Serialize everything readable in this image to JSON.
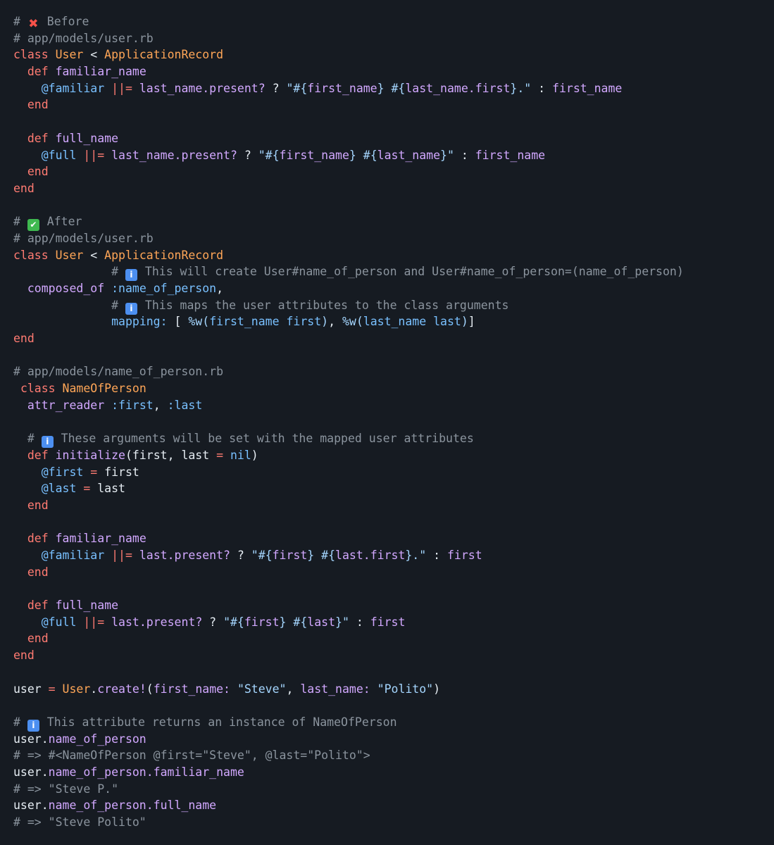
{
  "editor": {
    "theme_colors": {
      "background": "#161b22",
      "comment": "#8b949e",
      "keyword": "#ff7b72",
      "class": "#ffa657",
      "method": "#d2a8ff",
      "variable": "#79c0ff",
      "string": "#a5d6ff",
      "plain": "#e6edf3"
    },
    "lines": [
      [
        [
          "comment",
          "# "
        ],
        [
          "icon",
          "cross-mark-icon"
        ],
        [
          "comment",
          " Before"
        ]
      ],
      [
        [
          "comment",
          "# app/models/user.rb"
        ]
      ],
      [
        [
          "keyword",
          "class "
        ],
        [
          "class",
          "User"
        ],
        [
          "plain",
          " < "
        ],
        [
          "class",
          "ApplicationRecord"
        ]
      ],
      [
        [
          "plain",
          "  "
        ],
        [
          "keyword",
          "def "
        ],
        [
          "method",
          "familiar_name"
        ]
      ],
      [
        [
          "plain",
          "    "
        ],
        [
          "var",
          "@familiar"
        ],
        [
          "plain",
          " "
        ],
        [
          "op",
          "||="
        ],
        [
          "plain",
          " "
        ],
        [
          "method",
          "last_name.present?"
        ],
        [
          "plain",
          " ? "
        ],
        [
          "string",
          "\"#{"
        ],
        [
          "method",
          "first_name"
        ],
        [
          "string",
          "} #{"
        ],
        [
          "method",
          "last_name.first"
        ],
        [
          "string",
          "}.\""
        ],
        [
          "plain",
          " : "
        ],
        [
          "method",
          "first_name"
        ]
      ],
      [
        [
          "plain",
          "  "
        ],
        [
          "keyword",
          "end"
        ]
      ],
      [],
      [
        [
          "plain",
          "  "
        ],
        [
          "keyword",
          "def "
        ],
        [
          "method",
          "full_name"
        ]
      ],
      [
        [
          "plain",
          "    "
        ],
        [
          "var",
          "@full"
        ],
        [
          "plain",
          " "
        ],
        [
          "op",
          "||="
        ],
        [
          "plain",
          " "
        ],
        [
          "method",
          "last_name.present?"
        ],
        [
          "plain",
          " ? "
        ],
        [
          "string",
          "\"#{"
        ],
        [
          "method",
          "first_name"
        ],
        [
          "string",
          "} #{"
        ],
        [
          "method",
          "last_name"
        ],
        [
          "string",
          "}\""
        ],
        [
          "plain",
          " : "
        ],
        [
          "method",
          "first_name"
        ]
      ],
      [
        [
          "plain",
          "  "
        ],
        [
          "keyword",
          "end"
        ]
      ],
      [
        [
          "keyword",
          "end"
        ]
      ],
      [],
      [
        [
          "comment",
          "# "
        ],
        [
          "icon",
          "check-mark-icon"
        ],
        [
          "comment",
          " After"
        ]
      ],
      [
        [
          "comment",
          "# app/models/user.rb"
        ]
      ],
      [
        [
          "keyword",
          "class "
        ],
        [
          "class",
          "User"
        ],
        [
          "plain",
          " < "
        ],
        [
          "class",
          "ApplicationRecord"
        ]
      ],
      [
        [
          "plain",
          "              "
        ],
        [
          "comment",
          "# "
        ],
        [
          "icon",
          "info-icon"
        ],
        [
          "comment",
          " This will create User#name_of_person and User#name_of_person=(name_of_person)"
        ]
      ],
      [
        [
          "plain",
          "  "
        ],
        [
          "method",
          "composed_of"
        ],
        [
          "plain",
          " "
        ],
        [
          "var",
          ":name_of_person"
        ],
        [
          "plain",
          ","
        ]
      ],
      [
        [
          "plain",
          "              "
        ],
        [
          "comment",
          "# "
        ],
        [
          "icon",
          "info-icon"
        ],
        [
          "comment",
          " This maps the user attributes to the class arguments"
        ]
      ],
      [
        [
          "plain",
          "              "
        ],
        [
          "var",
          "mapping:"
        ],
        [
          "plain",
          " [ "
        ],
        [
          "string",
          "%w("
        ],
        [
          "var",
          "first_name first"
        ],
        [
          "string",
          ")"
        ],
        [
          "plain",
          ", "
        ],
        [
          "string",
          "%w("
        ],
        [
          "var",
          "last_name last"
        ],
        [
          "string",
          ")"
        ],
        [
          "plain",
          "]"
        ]
      ],
      [
        [
          "keyword",
          "end"
        ]
      ],
      [],
      [
        [
          "comment",
          "# app/models/name_of_person.rb"
        ]
      ],
      [
        [
          "plain",
          " "
        ],
        [
          "keyword",
          "class "
        ],
        [
          "class",
          "NameOfPerson"
        ]
      ],
      [
        [
          "plain",
          "  "
        ],
        [
          "method",
          "attr_reader"
        ],
        [
          "plain",
          " "
        ],
        [
          "var",
          ":first"
        ],
        [
          "plain",
          ", "
        ],
        [
          "var",
          ":last"
        ]
      ],
      [],
      [
        [
          "plain",
          "  "
        ],
        [
          "comment",
          "# "
        ],
        [
          "icon",
          "info-icon"
        ],
        [
          "comment",
          " These arguments will be set with the mapped user attributes"
        ]
      ],
      [
        [
          "plain",
          "  "
        ],
        [
          "keyword",
          "def "
        ],
        [
          "method",
          "initialize"
        ],
        [
          "plain",
          "(first, last "
        ],
        [
          "op",
          "="
        ],
        [
          "plain",
          " "
        ],
        [
          "const",
          "nil"
        ],
        [
          "plain",
          ")"
        ]
      ],
      [
        [
          "plain",
          "    "
        ],
        [
          "var",
          "@first"
        ],
        [
          "plain",
          " "
        ],
        [
          "op",
          "="
        ],
        [
          "plain",
          " first"
        ]
      ],
      [
        [
          "plain",
          "    "
        ],
        [
          "var",
          "@last"
        ],
        [
          "plain",
          " "
        ],
        [
          "op",
          "="
        ],
        [
          "plain",
          " last"
        ]
      ],
      [
        [
          "plain",
          "  "
        ],
        [
          "keyword",
          "end"
        ]
      ],
      [],
      [
        [
          "plain",
          "  "
        ],
        [
          "keyword",
          "def "
        ],
        [
          "method",
          "familiar_name"
        ]
      ],
      [
        [
          "plain",
          "    "
        ],
        [
          "var",
          "@familiar"
        ],
        [
          "plain",
          " "
        ],
        [
          "op",
          "||="
        ],
        [
          "plain",
          " "
        ],
        [
          "method",
          "last.present?"
        ],
        [
          "plain",
          " ? "
        ],
        [
          "string",
          "\"#{"
        ],
        [
          "method",
          "first"
        ],
        [
          "string",
          "} #{"
        ],
        [
          "method",
          "last.first"
        ],
        [
          "string",
          "}.\""
        ],
        [
          "plain",
          " : "
        ],
        [
          "method",
          "first"
        ]
      ],
      [
        [
          "plain",
          "  "
        ],
        [
          "keyword",
          "end"
        ]
      ],
      [],
      [
        [
          "plain",
          "  "
        ],
        [
          "keyword",
          "def "
        ],
        [
          "method",
          "full_name"
        ]
      ],
      [
        [
          "plain",
          "    "
        ],
        [
          "var",
          "@full"
        ],
        [
          "plain",
          " "
        ],
        [
          "op",
          "||="
        ],
        [
          "plain",
          " "
        ],
        [
          "method",
          "last.present?"
        ],
        [
          "plain",
          " ? "
        ],
        [
          "string",
          "\"#{"
        ],
        [
          "method",
          "first"
        ],
        [
          "string",
          "} #{"
        ],
        [
          "method",
          "last"
        ],
        [
          "string",
          "}\""
        ],
        [
          "plain",
          " : "
        ],
        [
          "method",
          "first"
        ]
      ],
      [
        [
          "plain",
          "  "
        ],
        [
          "keyword",
          "end"
        ]
      ],
      [
        [
          "keyword",
          "end"
        ]
      ],
      [],
      [
        [
          "plain",
          "user "
        ],
        [
          "op",
          "="
        ],
        [
          "plain",
          " "
        ],
        [
          "class",
          "User"
        ],
        [
          "plain",
          "."
        ],
        [
          "method",
          "create!"
        ],
        [
          "plain",
          "("
        ],
        [
          "method",
          "first_name:"
        ],
        [
          "plain",
          " "
        ],
        [
          "string",
          "\"Steve\""
        ],
        [
          "plain",
          ", "
        ],
        [
          "method",
          "last_name:"
        ],
        [
          "plain",
          " "
        ],
        [
          "string",
          "\"Polito\""
        ],
        [
          "plain",
          ")"
        ]
      ],
      [],
      [
        [
          "comment",
          "# "
        ],
        [
          "icon",
          "info-icon"
        ],
        [
          "comment",
          " This attribute returns an instance of NameOfPerson"
        ]
      ],
      [
        [
          "plain",
          "user."
        ],
        [
          "method",
          "name_of_person"
        ]
      ],
      [
        [
          "comment",
          "# => #<NameOfPerson @first=\"Steve\", @last=\"Polito\">"
        ]
      ],
      [
        [
          "plain",
          "user."
        ],
        [
          "method",
          "name_of_person.familiar_name"
        ]
      ],
      [
        [
          "comment",
          "# => \"Steve P.\""
        ]
      ],
      [
        [
          "plain",
          "user."
        ],
        [
          "method",
          "name_of_person.full_name"
        ]
      ],
      [
        [
          "comment",
          "# => \"Steve Polito\""
        ]
      ]
    ]
  }
}
